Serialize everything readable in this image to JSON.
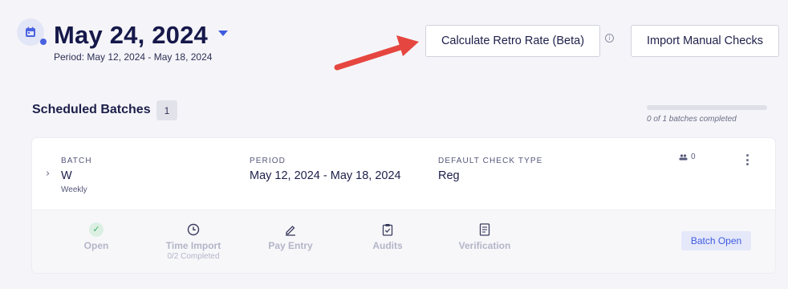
{
  "header": {
    "date_title": "May 24, 2024",
    "period": "Period: May 12, 2024 - May 18, 2024",
    "retro_button_label": "Calculate Retro Rate (Beta)",
    "import_button_label": "Import Manual Checks",
    "info_glyph": "i"
  },
  "batches": {
    "title": "Scheduled Batches",
    "count": "1",
    "progress_fraction": 0,
    "progress_text": "0 of 1 batches completed"
  },
  "batch": {
    "batch_label": "BATCH",
    "batch_value": "W",
    "batch_sub": "Weekly",
    "period_label": "PERIOD",
    "period_value": "May 12, 2024 - May 18, 2024",
    "check_type_label": "DEFAULT CHECK TYPE",
    "check_type_value": "Reg",
    "employee_count": "0",
    "status": "Batch Open",
    "steps": [
      {
        "label": "Open",
        "sub": "",
        "icon": "check-icon"
      },
      {
        "label": "Time Import",
        "sub": "0/2 Completed",
        "icon": "clock-icon"
      },
      {
        "label": "Pay Entry",
        "sub": "",
        "icon": "pencil-icon"
      },
      {
        "label": "Audits",
        "sub": "",
        "icon": "clipboard-check-icon"
      },
      {
        "label": "Verification",
        "sub": "",
        "icon": "document-icon"
      }
    ]
  },
  "colors": {
    "accent": "#4b63e0",
    "arrow": "#e5463f",
    "success": "#3fae6a",
    "muted_step": "#b3b5c7"
  }
}
